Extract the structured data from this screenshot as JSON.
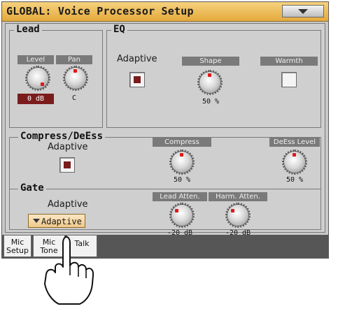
{
  "window": {
    "title": "GLOBAL: Voice Processor Setup"
  },
  "lead": {
    "title": "Lead",
    "level_label": "Level",
    "level_value": "0 dB",
    "pan_label": "Pan",
    "pan_value": "C"
  },
  "eq": {
    "title": "EQ",
    "adaptive_label": "Adaptive",
    "adaptive_checked": true,
    "shape_label": "Shape",
    "shape_value": "50 %",
    "warmth_label": "Warmth",
    "warmth_checked": false
  },
  "compress": {
    "title": "Compress/DeEss",
    "adaptive_label": "Adaptive",
    "adaptive_checked": true,
    "compress_label": "Compress",
    "compress_value": "50 %",
    "deess_label": "DeEss Level",
    "deess_value": "50 %"
  },
  "gate": {
    "title": "Gate",
    "adaptive_label": "Adaptive",
    "dropdown_value": "Adaptive",
    "lead_atten_label": "Lead Atten.",
    "lead_atten_value": "-20 dB",
    "harm_atten_label": "Harm. Atten.",
    "harm_atten_value": "-20 dB"
  },
  "tabs": [
    {
      "label": "Mic Setup",
      "line1": "Mic",
      "line2": "Setup"
    },
    {
      "label": "Mic Tone",
      "line1": "Mic",
      "line2": "Tone"
    },
    {
      "label": "Talk",
      "line1": "Talk",
      "line2": ""
    }
  ],
  "colors": {
    "title_bar": "#e9b24a",
    "value_box": "#7a1c1c",
    "indicator": "#e01818",
    "dropdown": "#f0c98a"
  },
  "icons": {
    "menu": "chevron-down-icon",
    "pointer": "pointing-hand-icon"
  }
}
